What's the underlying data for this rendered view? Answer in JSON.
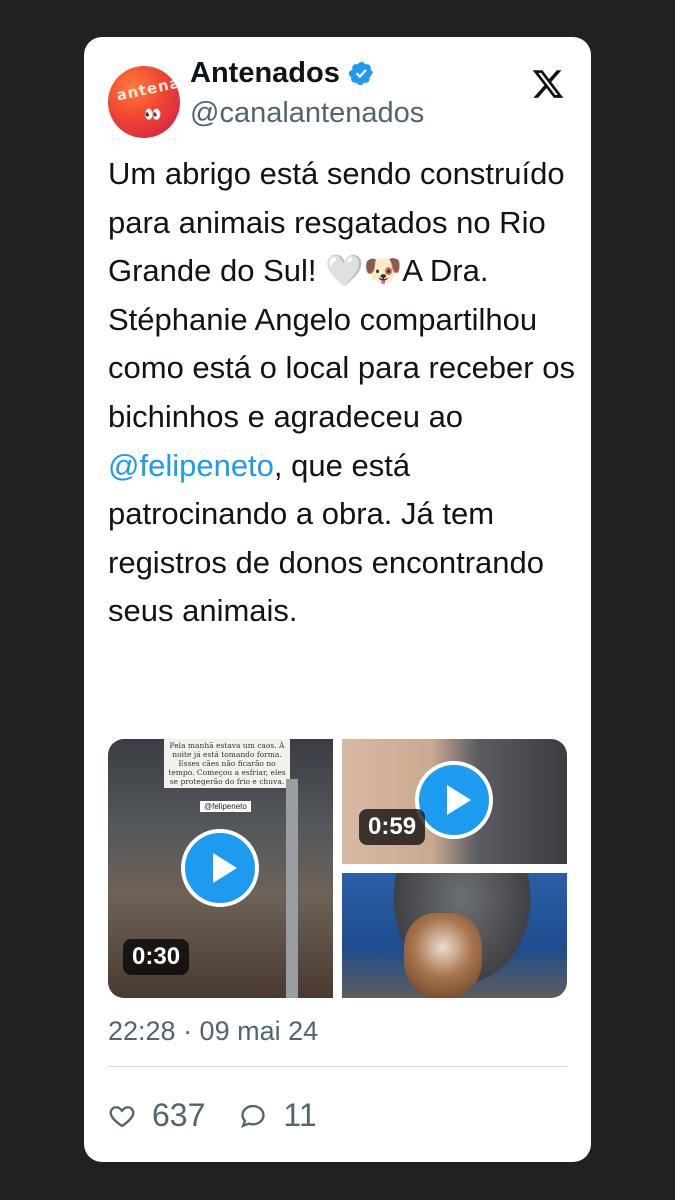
{
  "author": {
    "display_name": "Antenados",
    "handle": "@canalantenados",
    "avatar_text": "antena",
    "avatar_eyes": "👀"
  },
  "tweet": {
    "text_before": "Um abrigo está sendo construído para animais resgatados no Rio Grande do Sul! 🤍🐶A Dra. Stéphanie Angelo compartilhou como está o local para receber os bichinhos e agradeceu ao ",
    "mention": "@felipeneto",
    "text_after": ", que está patrocinando a obra. Já tem registros de donos encontrando seus animais."
  },
  "media": {
    "video1": {
      "duration": "0:30",
      "story_note": "Pela manhã estava um caos. À noite já está tomando forma. Esses cães não ficarão no tempo. Começou a esfriar, eles se protegerão do frio e chuva.",
      "tag": "@felipeneto"
    },
    "video2": {
      "duration": "0:59"
    }
  },
  "timestamp": "22:28 · 09 mai 24",
  "stats": {
    "likes": "637",
    "replies": "11"
  },
  "colors": {
    "accent": "#1d9bf0",
    "background": "#212121",
    "card": "#ffffff"
  }
}
